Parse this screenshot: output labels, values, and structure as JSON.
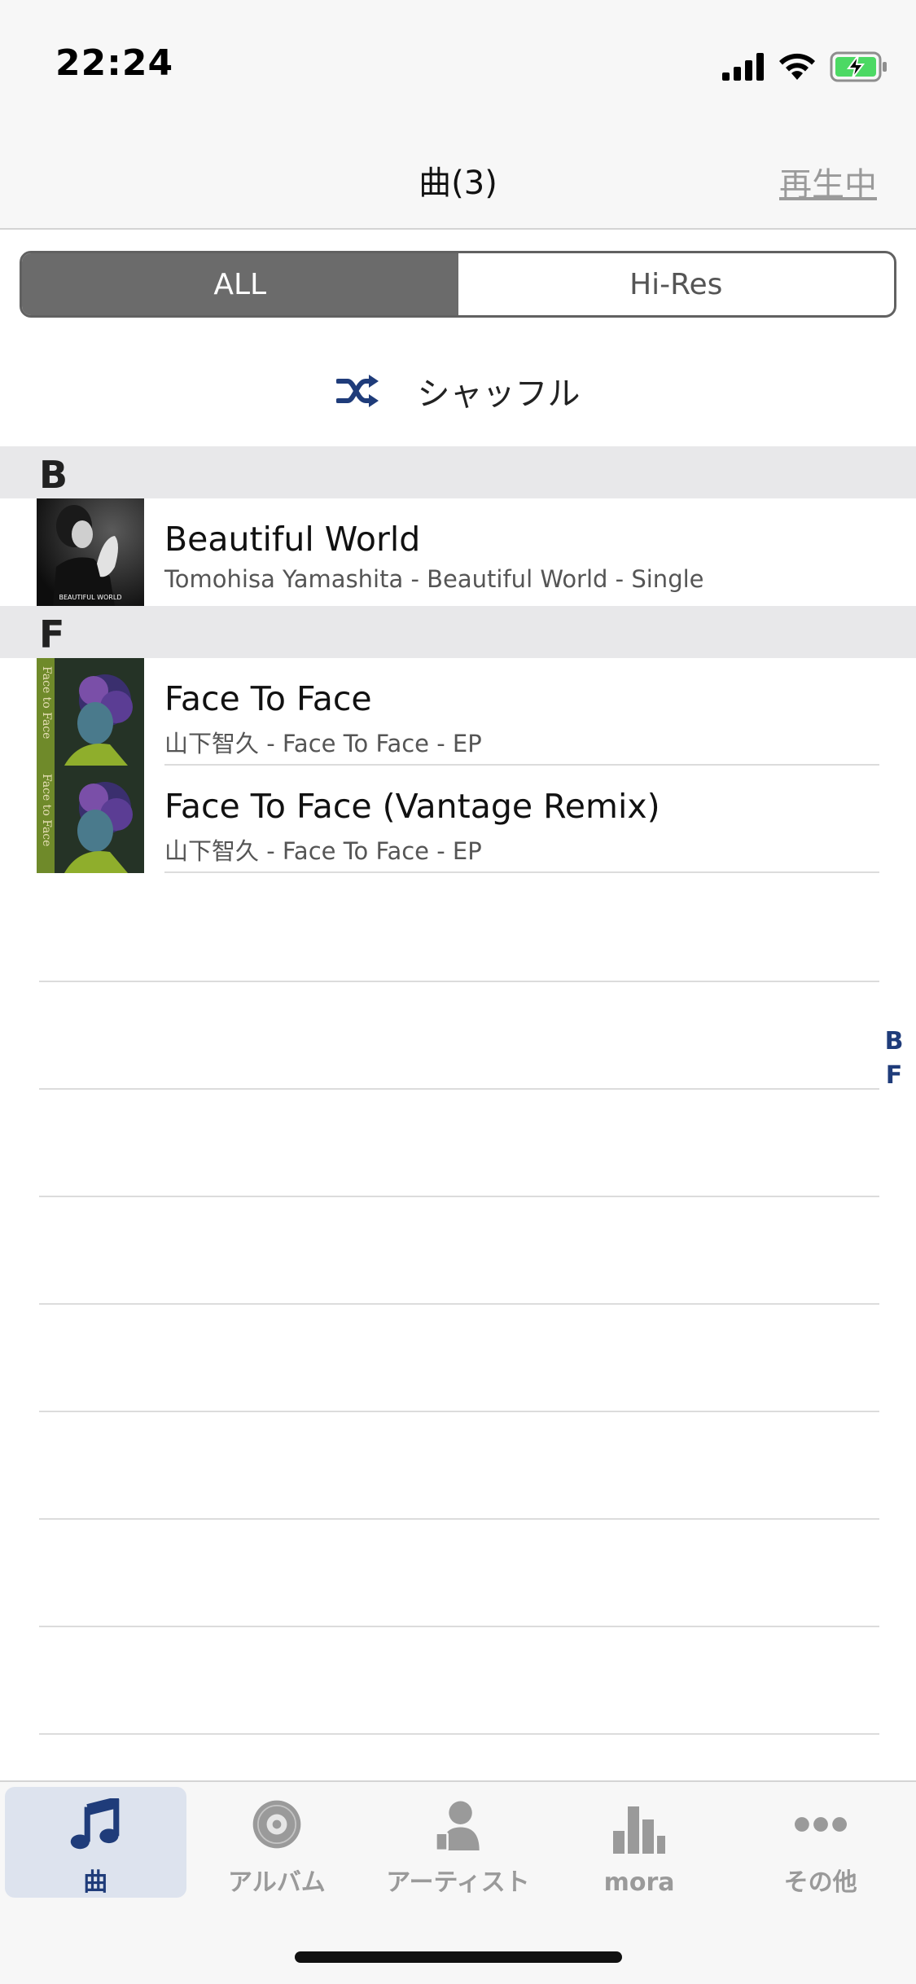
{
  "status": {
    "time": "22:24"
  },
  "nav": {
    "title": "曲(3)",
    "right": "再生中"
  },
  "segment": {
    "all": "ALL",
    "hires": "Hi-Res"
  },
  "shuffle": {
    "label": "シャッフル"
  },
  "sections": [
    {
      "letter": "B",
      "songs": [
        {
          "title": "Beautiful World",
          "subtitle": "Tomohisa Yamashita - Beautiful World - Single",
          "art_caption": "BEAUTIFUL WORLD"
        }
      ]
    },
    {
      "letter": "F",
      "songs": [
        {
          "title": "Face To Face",
          "subtitle": "山下智久 - Face To Face - EP",
          "art_caption": "Face to Face"
        },
        {
          "title": "Face To Face (Vantage Remix)",
          "subtitle": "山下智久 - Face To Face - EP",
          "art_caption": "Face to Face"
        }
      ]
    }
  ],
  "index": [
    "B",
    "F"
  ],
  "tabs": [
    {
      "label": "曲",
      "icon": "music-note-icon",
      "active": true
    },
    {
      "label": "アルバム",
      "icon": "disc-icon",
      "active": false
    },
    {
      "label": "アーティスト",
      "icon": "artist-icon",
      "active": false
    },
    {
      "label": "mora",
      "icon": "mora-icon",
      "active": false
    },
    {
      "label": "その他",
      "icon": "more-icon",
      "active": false
    }
  ],
  "colors": {
    "accent": "#1f3c7a",
    "segment_active": "#6b6b6b",
    "section_bg": "#e8e8ea",
    "tab_active_bg": "#dde3ee",
    "battery": "#4cd964"
  }
}
